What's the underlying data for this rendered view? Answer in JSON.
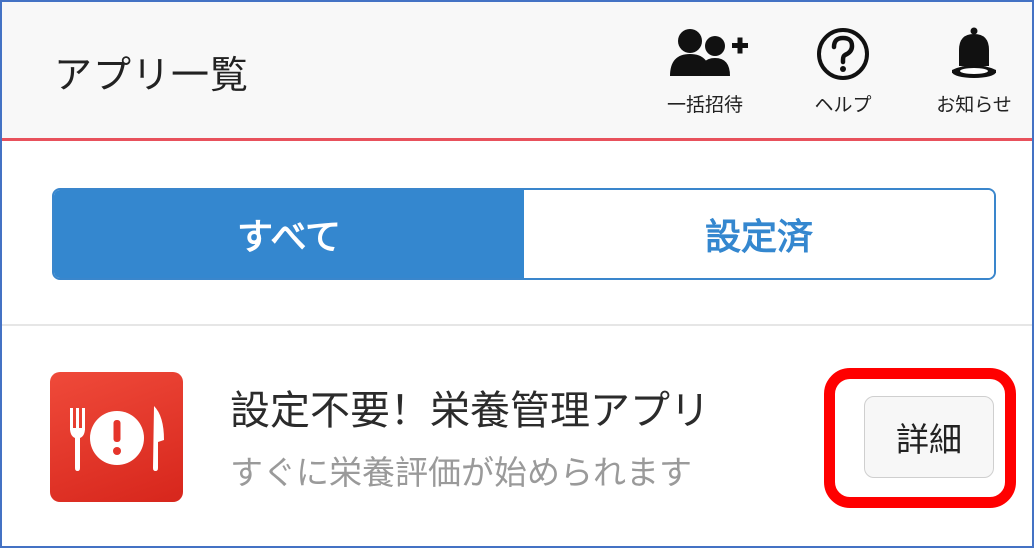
{
  "header": {
    "title": "アプリ一覧",
    "actions": [
      {
        "label": "一括招待",
        "icon": "invite-users-icon"
      },
      {
        "label": "ヘルプ",
        "icon": "help-icon"
      },
      {
        "label": "お知らせ",
        "icon": "bell-icon"
      }
    ],
    "accent_line_color": "#e8515c"
  },
  "filter_tabs": {
    "items": [
      {
        "label": "すべて",
        "active": true
      },
      {
        "label": "設定済",
        "active": false
      }
    ],
    "accent_color": "#3487cf"
  },
  "apps": [
    {
      "name": "設定不要！栄養管理アプリ",
      "description": "すぐに栄養評価が始められます",
      "icon": "cutlery-alert-icon",
      "icon_color": "#e5352b",
      "detail_button_label": "詳細",
      "highlighted": true,
      "highlight_color": "#ff0000"
    }
  ]
}
